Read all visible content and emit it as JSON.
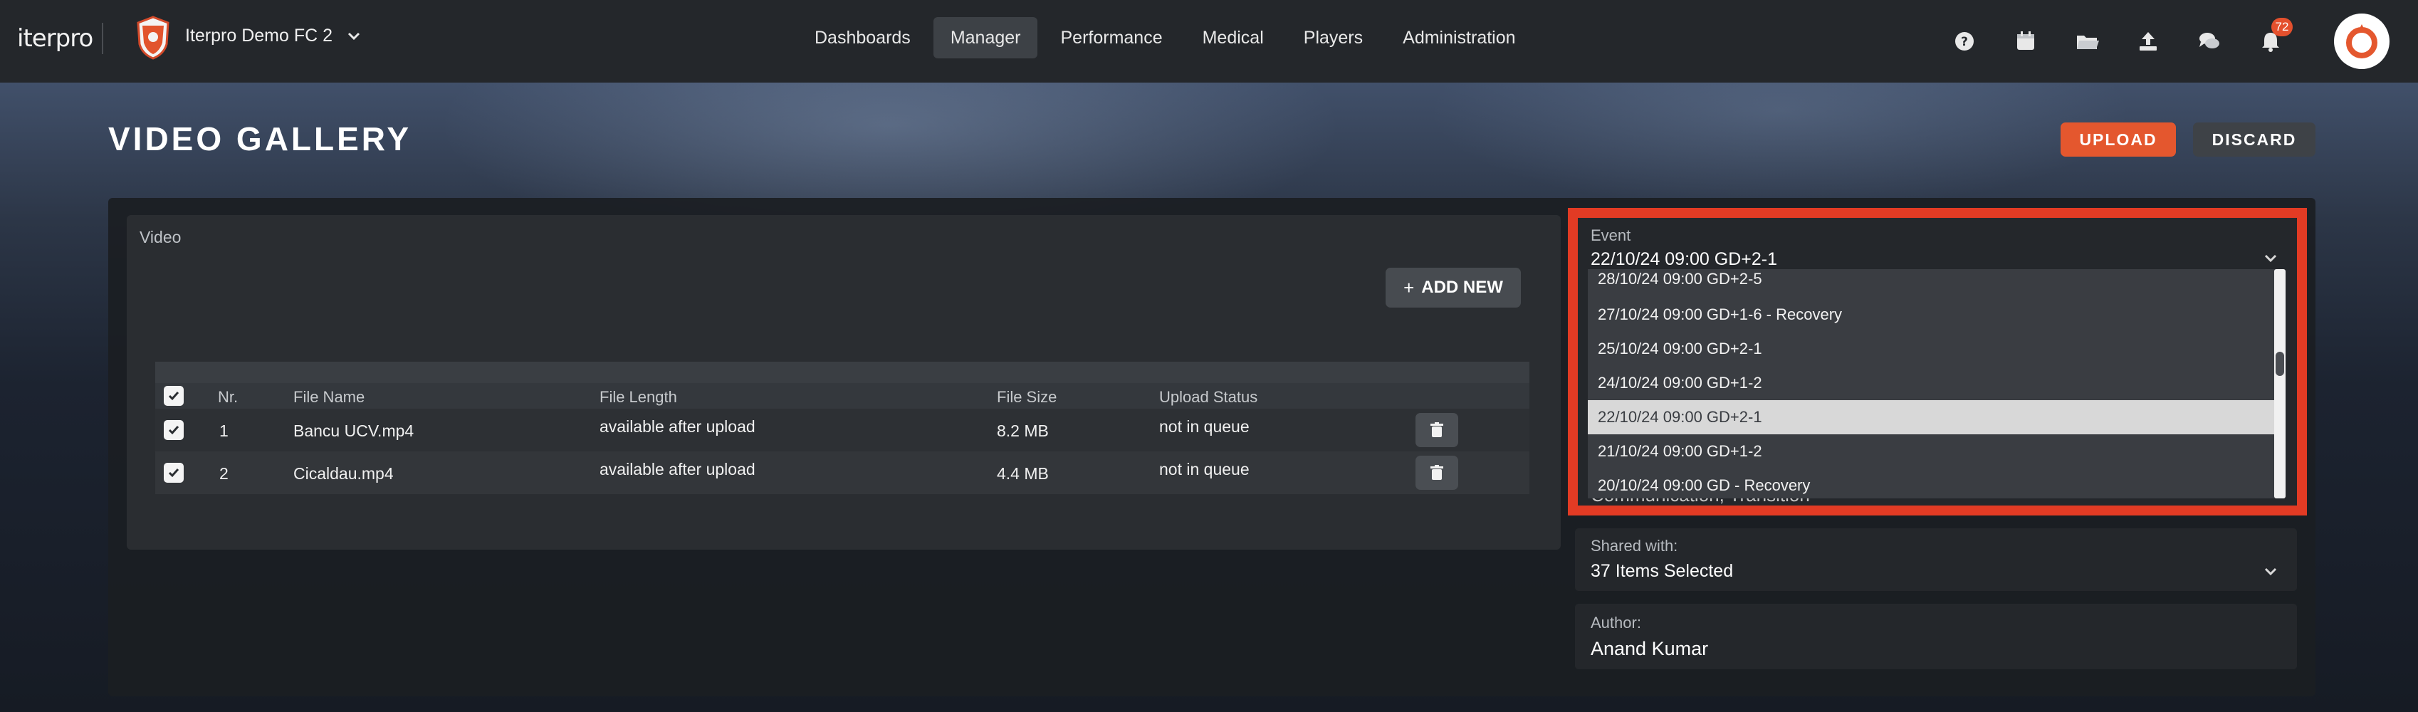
{
  "app": {
    "logo": "iterpro",
    "club_name": "Iterpro Demo FC 2"
  },
  "nav": {
    "items": [
      "Dashboards",
      "Manager",
      "Performance",
      "Medical",
      "Players",
      "Administration"
    ],
    "active": "Manager"
  },
  "top_icons": [
    "help-icon",
    "calendar-icon",
    "folder-icon",
    "upload-icon",
    "chat-icon",
    "bell-icon"
  ],
  "notifications": {
    "count": "72"
  },
  "page": {
    "title": "VIDEO GALLERY",
    "upload_label": "UPLOAD",
    "discard_label": "DISCARD"
  },
  "video": {
    "label": "Video",
    "add_new_label": "ADD NEW",
    "columns": [
      "Nr.",
      "File Name",
      "File Length",
      "File Size",
      "Upload Status"
    ],
    "rows": [
      {
        "nr": "1",
        "file_name": "Bancu UCV.mp4",
        "file_length": "available after upload",
        "file_size": "8.2 MB",
        "status": "not in queue"
      },
      {
        "nr": "2",
        "file_name": "Cicaldau.mp4",
        "file_length": "available after upload",
        "file_size": "4.4 MB",
        "status": "not in queue"
      }
    ]
  },
  "event": {
    "label": "Event",
    "value": "22/10/24 09:00 GD+2-1",
    "options": [
      "28/10/24 09:00 GD+2-5",
      "27/10/24 09:00 GD+1-6 - Recovery",
      "25/10/24 09:00 GD+2-1",
      "24/10/24 09:00 GD+1-2",
      "22/10/24 09:00 GD+2-1",
      "21/10/24 09:00 GD+1-2",
      "20/10/24 09:00 GD - Recovery"
    ],
    "selected_option": "22/10/24 09:00 GD+2-1",
    "partially_hidden_text": "Communication, Transition"
  },
  "shared_with": {
    "label": "Shared with:",
    "value": "37 Items Selected"
  },
  "author": {
    "label": "Author:",
    "value": "Anand Kumar"
  },
  "colors": {
    "accent": "#e4572e",
    "highlight_border": "#e23b24",
    "badge": "#e4502d"
  }
}
